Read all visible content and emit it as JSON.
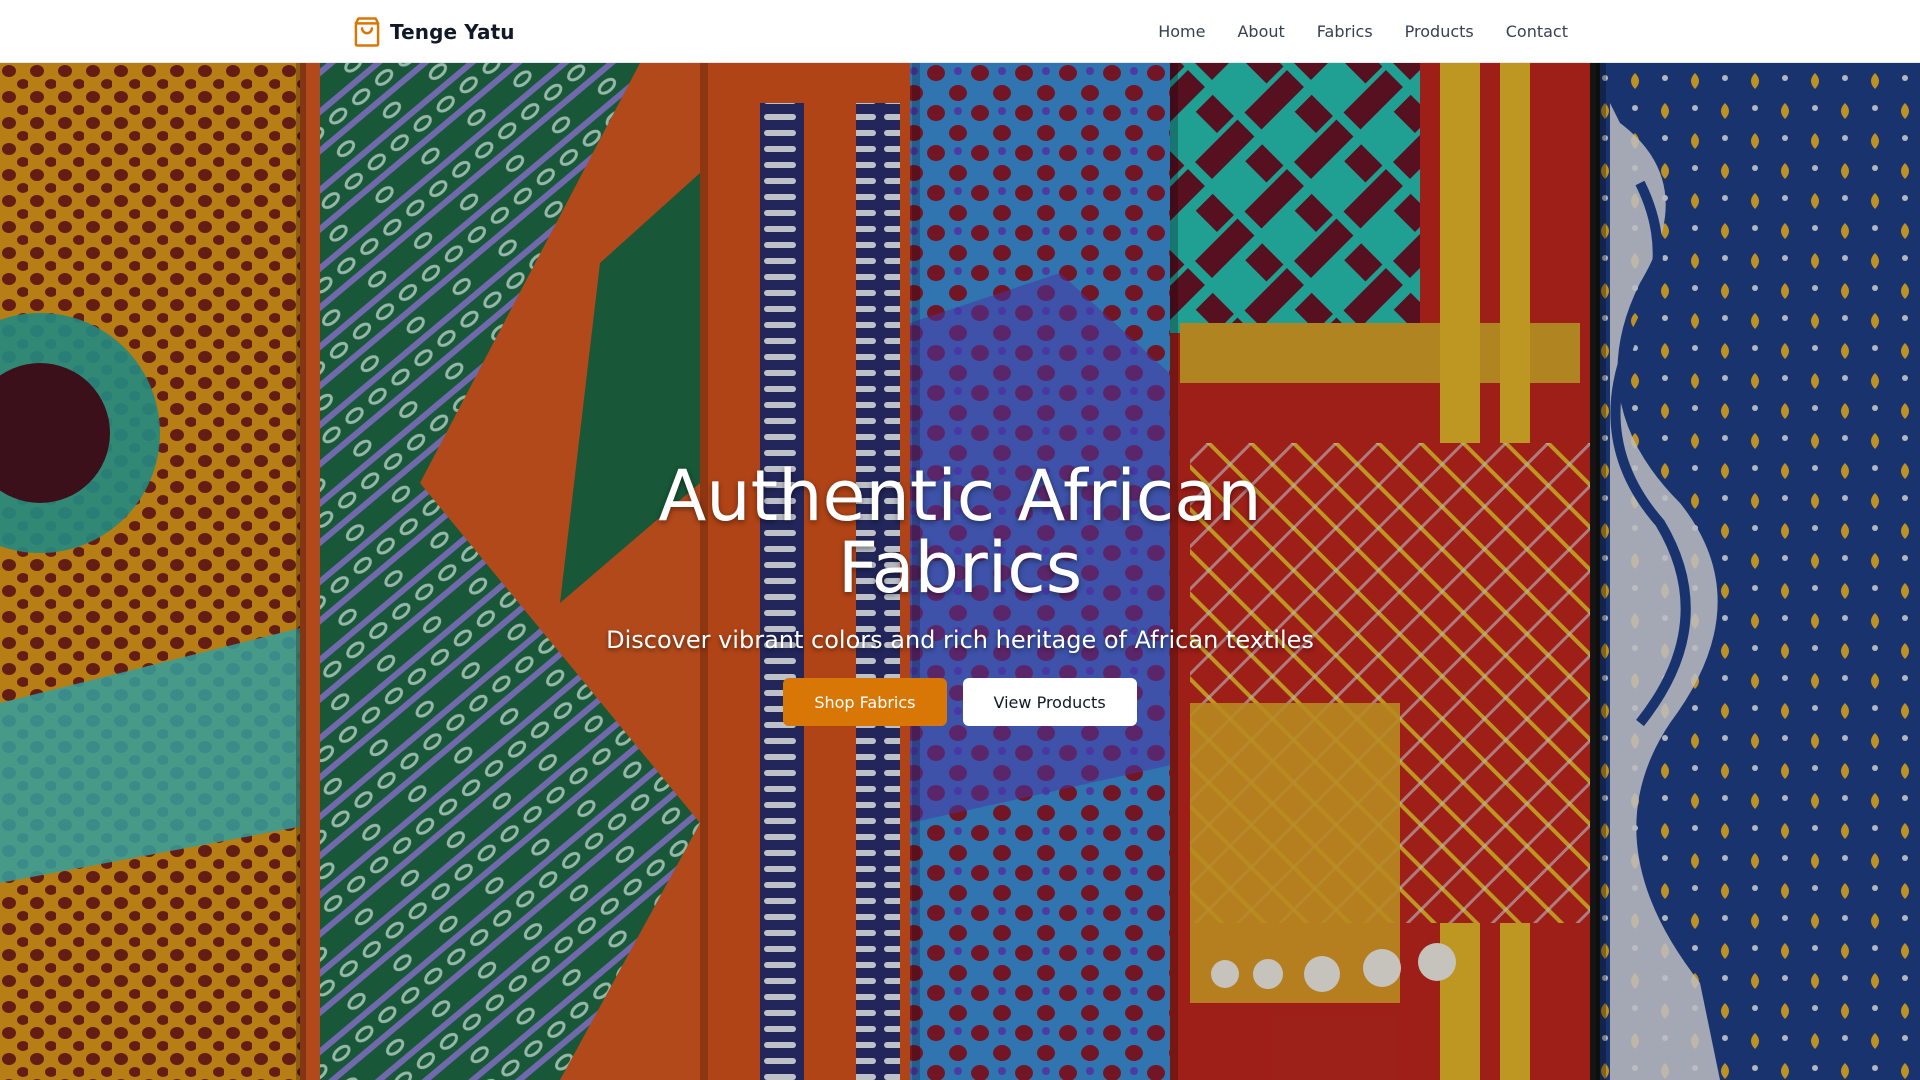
{
  "brand": {
    "name": "Tenge Yatu",
    "icon": "shopping-bag-icon",
    "icon_color": "#d97706"
  },
  "nav": {
    "items": [
      {
        "label": "Home"
      },
      {
        "label": "About"
      },
      {
        "label": "Fabrics"
      },
      {
        "label": "Products"
      },
      {
        "label": "Contact"
      }
    ]
  },
  "hero": {
    "title": "Authentic African Fabrics",
    "subtitle": "Discover vibrant colors and rich heritage of African textiles",
    "primary_button": "Shop Fabrics",
    "secondary_button": "View Products",
    "background": "african-wax-print-fabrics-image"
  },
  "colors": {
    "accent": "#d97706",
    "header_bg": "#ffffff",
    "nav_text": "#374151"
  }
}
